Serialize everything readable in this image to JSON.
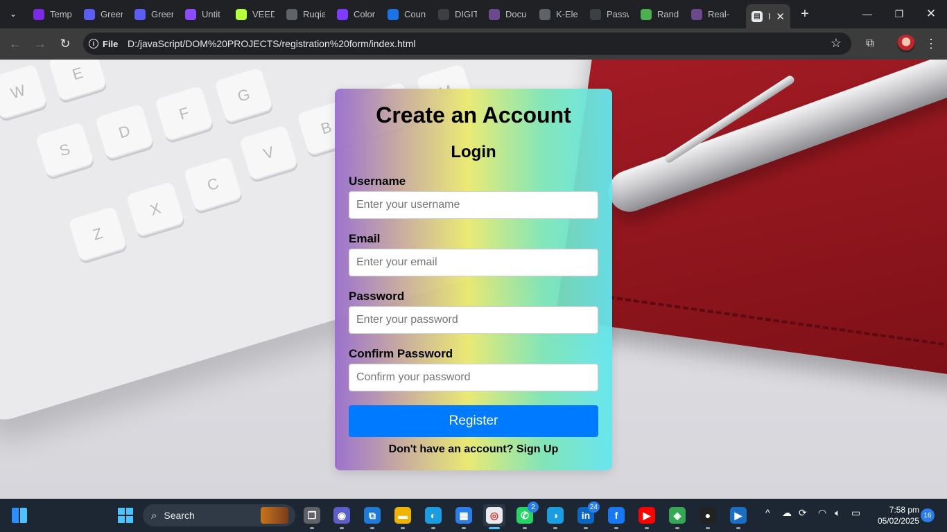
{
  "browser": {
    "tabs": [
      {
        "label": "Temp",
        "icon": "canva-icon",
        "color": "#7d2ae8"
      },
      {
        "label": "Green",
        "icon": "form-icon",
        "color": "#5b5ef5"
      },
      {
        "label": "Green",
        "icon": "form-icon",
        "color": "#5b5ef5"
      },
      {
        "label": "Untit",
        "icon": "app-icon",
        "color": "#8c4bff"
      },
      {
        "label": "VEED",
        "icon": "veed-icon",
        "color": "#b6ff3b"
      },
      {
        "label": "Ruqia",
        "icon": "globe-icon",
        "color": "#5f6368"
      },
      {
        "label": "Color",
        "icon": "color-icon",
        "color": "#7d3cff"
      },
      {
        "label": "Coun",
        "icon": "counter-icon",
        "color": "#1a73e8"
      },
      {
        "label": "DIGIT",
        "icon": "clock-icon",
        "color": "#3c4043"
      },
      {
        "label": "Docu",
        "icon": "doc-icon",
        "color": "#6a4a8c"
      },
      {
        "label": "K-Ele",
        "icon": "globe-icon",
        "color": "#5f6368"
      },
      {
        "label": "Passw",
        "icon": "lock-icon",
        "color": "#3c4043"
      },
      {
        "label": "Rand",
        "icon": "image-icon",
        "color": "#4caf50"
      },
      {
        "label": "Real-",
        "icon": "app-icon",
        "color": "#6a4a8c"
      }
    ],
    "active_tab": {
      "label": "I",
      "icon": "page-icon"
    },
    "address": {
      "chip": "File",
      "url": "D:/javaScript/DOM%20PROJECTS/registration%20form/index.html"
    }
  },
  "form": {
    "title": "Create an Account",
    "subtitle": "Login",
    "fields": [
      {
        "label": "Username",
        "placeholder": "Enter your username"
      },
      {
        "label": "Email",
        "placeholder": "Enter your email"
      },
      {
        "label": "Password",
        "placeholder": "Enter your password"
      },
      {
        "label": "Confirm Password",
        "placeholder": "Confirm your password"
      }
    ],
    "button": "Register",
    "signup_text": "Don't have an account? Sign Up",
    "accent": "#007bff"
  },
  "background": {
    "keys": [
      "W",
      "E",
      "H",
      "S",
      "D",
      "F",
      "G",
      "B",
      "N",
      "M",
      "V",
      "C",
      "X",
      "Z"
    ]
  },
  "taskbar": {
    "search_label": "Search",
    "apps": [
      {
        "name": "task-view",
        "glyph": "❐"
      },
      {
        "name": "meet",
        "glyph": "◉"
      },
      {
        "name": "vscode",
        "glyph": "⧉"
      },
      {
        "name": "file-explorer",
        "glyph": "▬"
      },
      {
        "name": "edge",
        "glyph": "◐"
      },
      {
        "name": "store",
        "glyph": "▦"
      },
      {
        "name": "chrome",
        "glyph": "◎"
      },
      {
        "name": "whatsapp",
        "glyph": "✆",
        "badge": "2"
      },
      {
        "name": "edge-profile",
        "glyph": "◑"
      },
      {
        "name": "linkedin",
        "glyph": "in",
        "badge": "24"
      },
      {
        "name": "facebook",
        "glyph": "f"
      },
      {
        "name": "youtube",
        "glyph": "▶"
      },
      {
        "name": "maps",
        "glyph": "◈"
      },
      {
        "name": "recorder",
        "glyph": "●"
      },
      {
        "name": "media-player",
        "glyph": "▶"
      }
    ],
    "time": "7:58 pm",
    "date": "05/02/2025",
    "notification_count": "16"
  }
}
